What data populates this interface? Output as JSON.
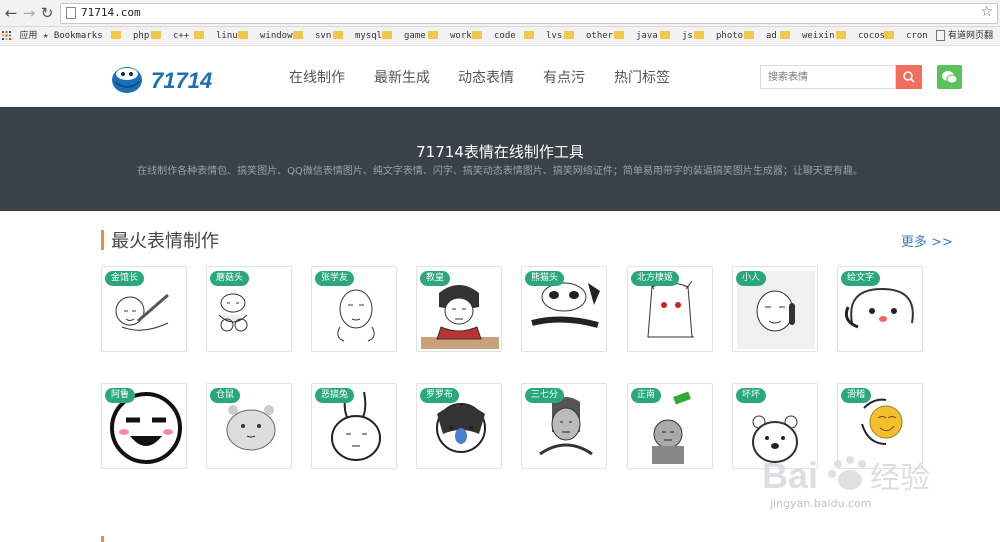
{
  "browser": {
    "url": "71714.com",
    "bookmarks": [
      "应用",
      "Bookmarks",
      "php",
      "c++",
      "linux",
      "window",
      "svn",
      "mysql",
      "game",
      "work",
      "code",
      "lvs",
      "other",
      "java",
      "js",
      "photo",
      "ad",
      "weixin",
      "cocos",
      "cron",
      "有道网页翻"
    ]
  },
  "header": {
    "nav": [
      "在线制作",
      "最新生成",
      "动态表情",
      "有点污",
      "热门标签"
    ],
    "search_placeholder": "搜索表情"
  },
  "banner": {
    "title": "71714表情在线制作工具",
    "subtitle": "在线制作各种表情包、搞笑图片、QQ微信表情图片、纯文字表情、闪字、搞笑动态表情图片、搞笑网络证件；简单易用带字的装逼搞笑图片生成器；让聊天更有趣。"
  },
  "section": {
    "title": "最火表情制作",
    "more": "更多 >>",
    "items": [
      "金馆长",
      "蘑菇头",
      "张学友",
      "教皇",
      "熊猫头",
      "北方棲姬",
      "小人",
      "绘文字",
      "阿鲁",
      "仓鼠",
      "恶搞兔",
      "罗罗布",
      "三七分",
      "正南",
      "坏坏",
      "滑稽"
    ]
  },
  "watermark": {
    "text": "jingyan.baidu.com"
  },
  "colors": {
    "accent": "#2aa77d",
    "banner": "#3a4148",
    "search": "#f26d5b",
    "wechat": "#59c25a",
    "link": "#3e7dc4",
    "bar": "#f08b3a"
  }
}
